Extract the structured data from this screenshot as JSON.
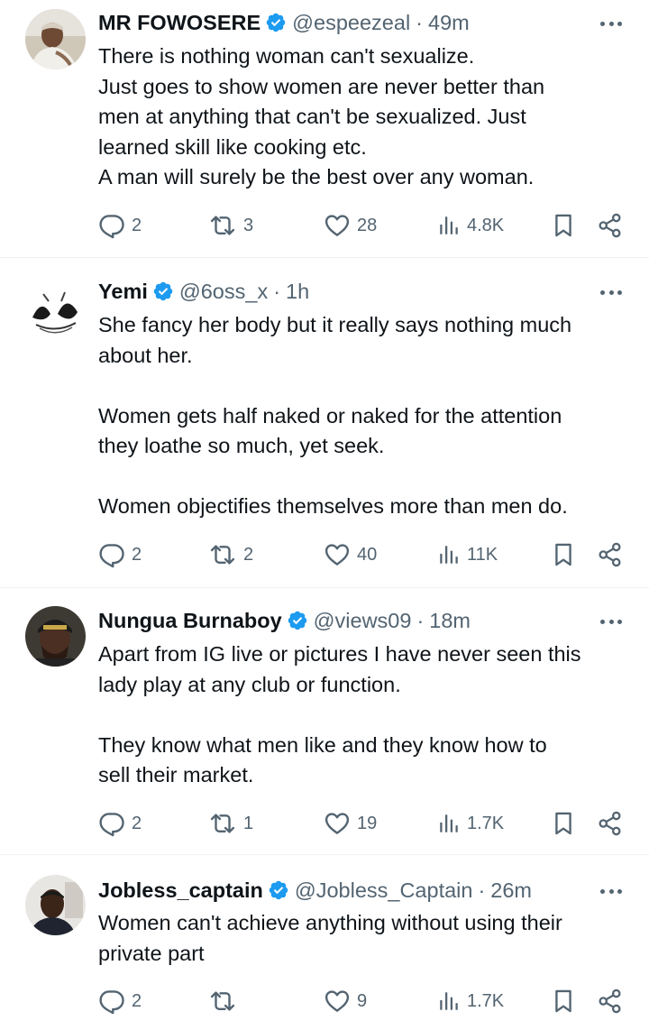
{
  "colors": {
    "accent": "#1d9bf0",
    "muted": "#536471",
    "text": "#0f1419",
    "divider": "#eff3f4"
  },
  "tweets": [
    {
      "name": "MR FOWOSERE",
      "handle": "@espeezeal",
      "dot": "·",
      "time": "49m",
      "lines": [
        "There is nothing woman can't sexualize.",
        "Just goes to show women are never better than",
        "men at anything that can't be sexualized. Just",
        "learned skill like cooking etc.",
        "A man will surely be the best over any woman."
      ],
      "replies": "2",
      "reposts": "3",
      "likes": "28",
      "views": "4.8K"
    },
    {
      "name": "Yemi",
      "handle": "@6oss_x",
      "dot": "·",
      "time": "1h",
      "lines": [
        "She fancy her body but it really says nothing much",
        "about her.",
        "",
        "Women gets half naked or naked for the attention",
        "they loathe so much, yet seek.",
        "",
        "Women objectifies themselves more than men do."
      ],
      "replies": "2",
      "reposts": "2",
      "likes": "40",
      "views": "11K"
    },
    {
      "name": "Nungua Burnaboy",
      "handle": "@views09",
      "dot": "·",
      "time": "18m",
      "lines": [
        "Apart from IG live or pictures I have never seen this",
        "lady play at any club or function.",
        "",
        "They know what men like and they know how to",
        "sell their market."
      ],
      "replies": "2",
      "reposts": "1",
      "likes": "19",
      "views": "1.7K"
    },
    {
      "name": "Jobless_captain",
      "handle": "@Jobless_Captain",
      "dot": "·",
      "time": "26m",
      "lines": [
        "Women can't achieve anything without using their",
        "private part"
      ],
      "replies": "2",
      "reposts": "",
      "likes": "9",
      "views": "1.7K"
    }
  ]
}
